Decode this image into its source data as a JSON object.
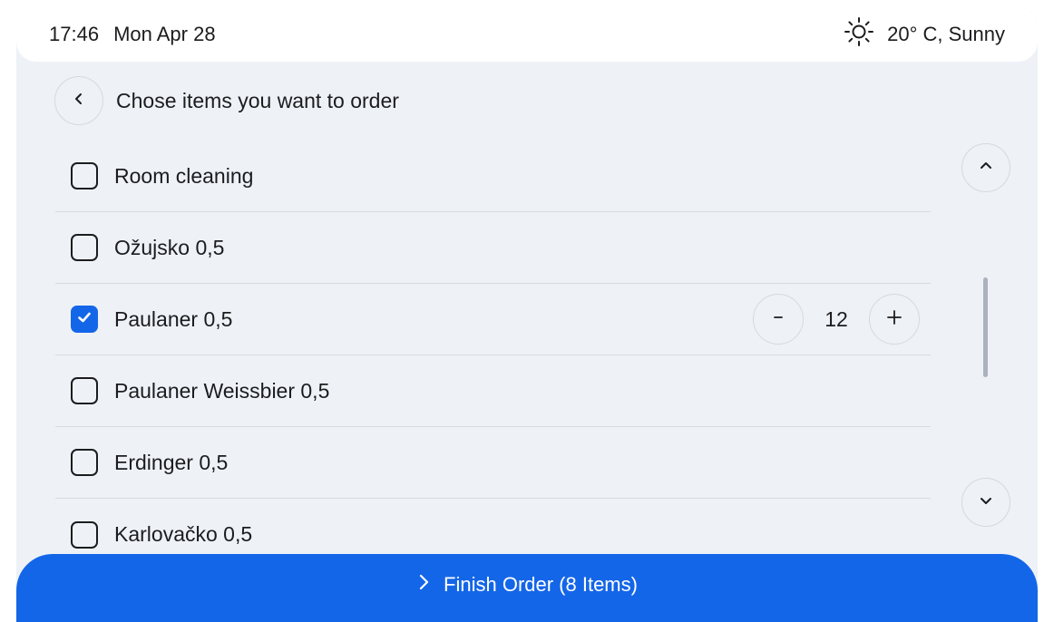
{
  "status": {
    "time": "17:46",
    "date": "Mon Apr 28",
    "weather": "20° C, Sunny",
    "weather_icon": "sun-icon"
  },
  "header": {
    "title": "Chose items you want to order",
    "back_icon": "chevron-left-icon"
  },
  "items": [
    {
      "label": "Room cleaning",
      "checked": false
    },
    {
      "label": "Ožujsko 0,5",
      "checked": false
    },
    {
      "label": "Paulaner 0,5",
      "checked": true,
      "quantity": "12"
    },
    {
      "label": "Paulaner Weissbier 0,5",
      "checked": false
    },
    {
      "label": "Erdinger 0,5",
      "checked": false
    },
    {
      "label": "Karlovačko 0,5",
      "checked": false
    }
  ],
  "finish": {
    "label": "Finish Order (8 Items)"
  },
  "colors": {
    "accent": "#1466e8",
    "background": "#eef2f7",
    "divider": "#d6dbe2"
  }
}
